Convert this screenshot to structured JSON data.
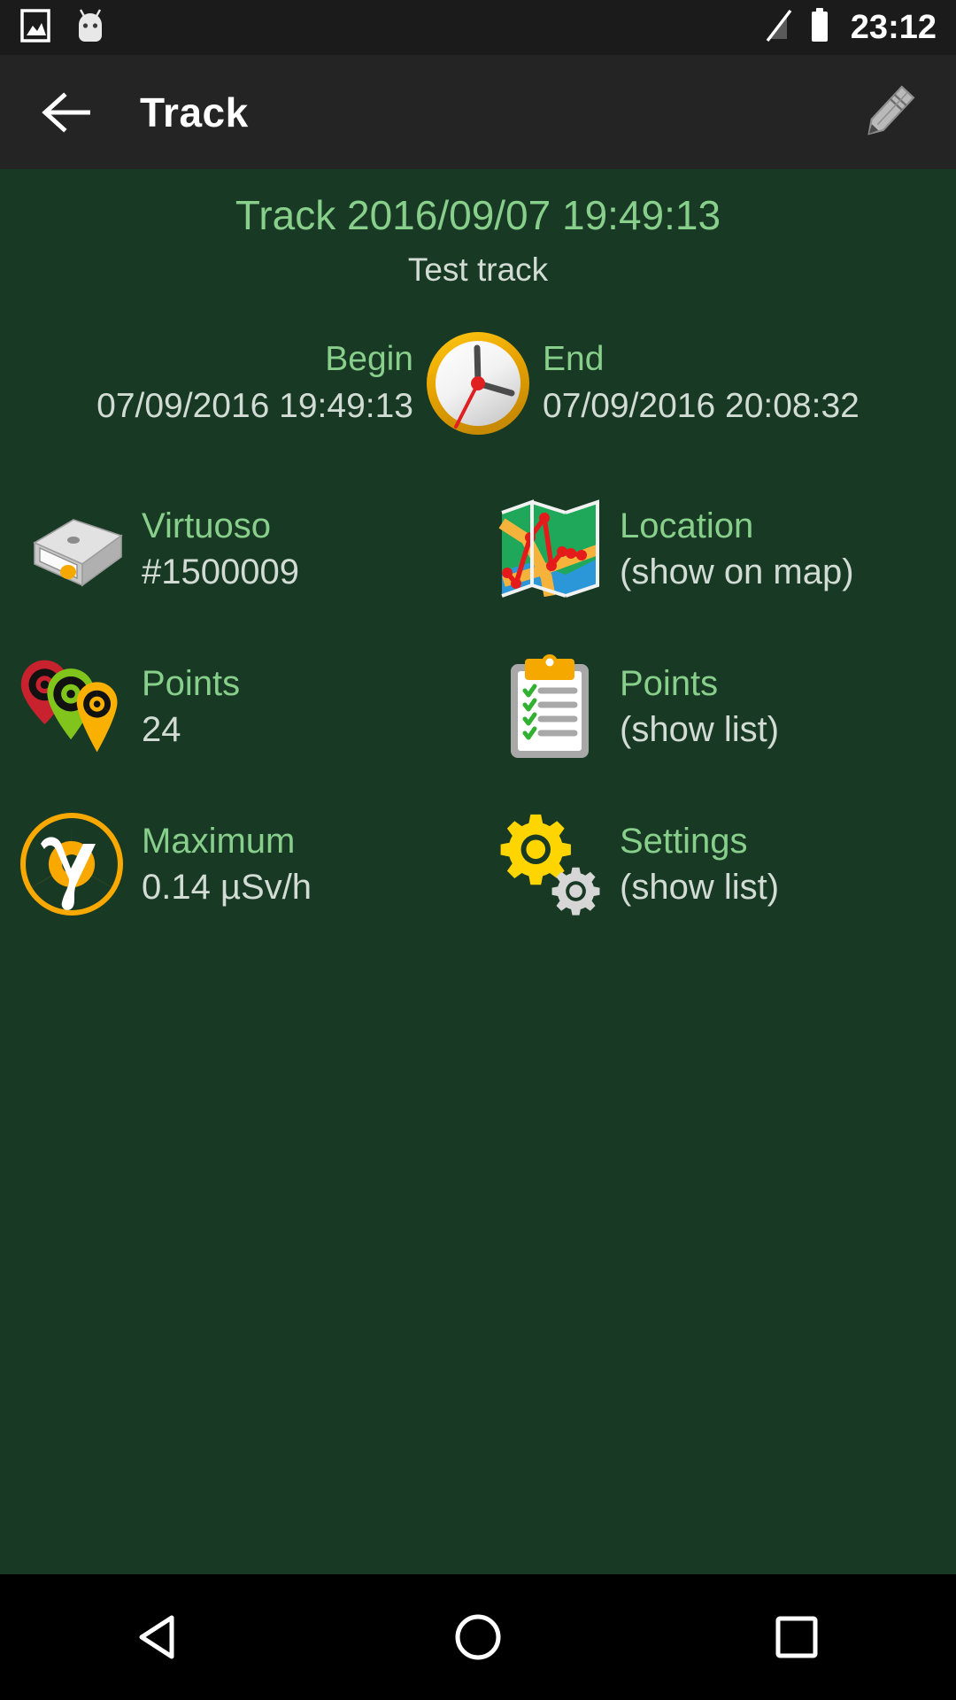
{
  "status_bar": {
    "icons": [
      "gallery-icon",
      "android-head-icon",
      "signal-off-icon",
      "battery-icon"
    ],
    "time": "23:12"
  },
  "toolbar": {
    "back_icon": "back-arrow-icon",
    "title": "Track",
    "edit_icon": "pencil-icon"
  },
  "track": {
    "title": "Track 2016/09/07 19:49:13",
    "subtitle": "Test track"
  },
  "times": {
    "clock_icon": "clock-icon",
    "begin_label": "Begin",
    "begin_value": "07/09/2016 19:49:13",
    "end_label": "End",
    "end_value": "07/09/2016 20:08:32"
  },
  "grid": {
    "device": {
      "icon": "hard-drive-icon",
      "primary": "Virtuoso",
      "secondary": "#1500009"
    },
    "location": {
      "icon": "map-icon",
      "primary": "Location",
      "secondary": "(show on map)"
    },
    "points_count": {
      "icon": "radiation-markers-icon",
      "primary": "Points",
      "secondary": "24"
    },
    "points_list": {
      "icon": "clipboard-icon",
      "primary": "Points",
      "secondary": "(show list)"
    },
    "maximum": {
      "icon": "gamma-radiation-icon",
      "primary": "Maximum",
      "secondary": "0.14 µSv/h"
    },
    "settings": {
      "icon": "gears-icon",
      "primary": "Settings",
      "secondary": "(show list)"
    }
  },
  "nav_bar": {
    "back": "nav-back-triangle-icon",
    "home": "nav-home-circle-icon",
    "recents": "nav-recents-square-icon"
  },
  "colors": {
    "background": "#183a24",
    "toolbar": "#242424",
    "status_bar": "#1b1b1b",
    "accent_green": "#88cf8c",
    "text_light": "#d2dcd4",
    "amber": "#f5a800",
    "yellow": "#ffd700"
  }
}
